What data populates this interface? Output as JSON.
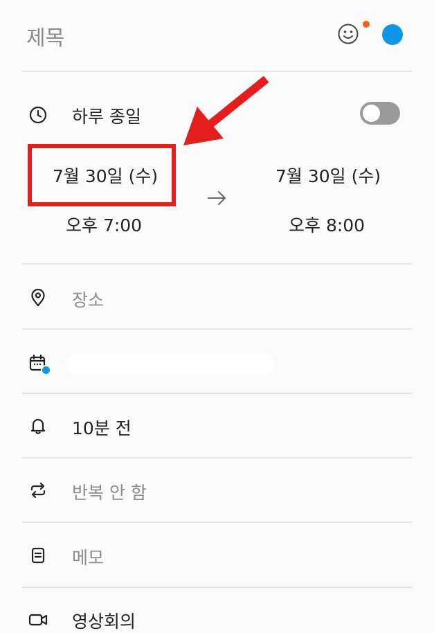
{
  "header": {
    "title_placeholder": "제목",
    "emoji_icon": "smiley-face-icon",
    "notification_dot_color": "#e8651a",
    "calendar_color": "#0f97e6"
  },
  "all_day": {
    "label": "하루 종일",
    "enabled": false
  },
  "start": {
    "date": "7월 30일 (수)",
    "time": "오후 7:00"
  },
  "end": {
    "date": "7월 30일 (수)",
    "time": "오후 8:00"
  },
  "location": {
    "placeholder": "장소"
  },
  "reminder": {
    "value": "10분 전"
  },
  "repeat": {
    "value": "반복 안 함"
  },
  "memo": {
    "placeholder": "메모"
  },
  "video_call": {
    "label": "영상회의"
  },
  "annotation": {
    "color": "#e41e1e"
  }
}
